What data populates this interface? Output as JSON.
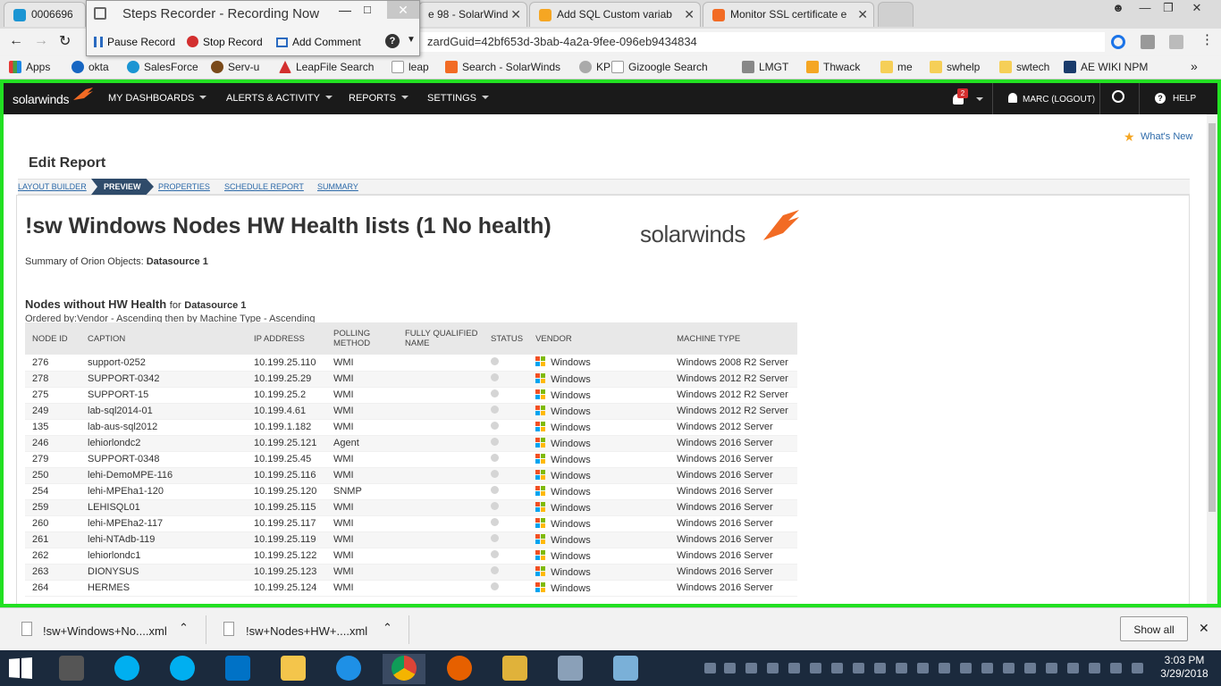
{
  "browser": {
    "tabs": [
      {
        "title": "0006696",
        "icon_color": "#1b95d3"
      },
      {
        "title": "e 98 - SolarWind",
        "icon_color": "#f57c00"
      },
      {
        "title": "Add SQL Custom variab",
        "icon_color": "#f5a623"
      },
      {
        "title": "Monitor SSL certificate e",
        "icon_color": "#f26b24"
      }
    ],
    "url": "zardGuid=42bf653d-3bab-4a2a-9fee-096eb9434834",
    "bookmarks": [
      "Apps",
      "okta",
      "SalesForce",
      "Serv-u",
      "LeapFile Search",
      "leap",
      "Search - SolarWinds",
      "KPI",
      "Gizoogle Search",
      "LMGT",
      "Thwack",
      "me",
      "swhelp",
      "swtech",
      "AE WIKI NPM"
    ],
    "bookmarks_more": "»"
  },
  "steps_recorder": {
    "title": "Steps Recorder - Recording Now",
    "pause": "Pause Record",
    "stop": "Stop Record",
    "comment": "Add Comment",
    "help": "?"
  },
  "swnav": {
    "logo": "solarwinds",
    "menus": [
      "MY DASHBOARDS",
      "ALERTS & ACTIVITY",
      "REPORTS",
      "SETTINGS"
    ],
    "alert_count": "2",
    "user": "MARC (LOGOUT)",
    "help": "HELP"
  },
  "page": {
    "whats_new": "What's New",
    "title": "Edit Report",
    "crumbs": [
      "LAYOUT BUILDER",
      "PREVIEW",
      "PROPERTIES",
      "SCHEDULE REPORT",
      "SUMMARY"
    ]
  },
  "report": {
    "title": "!sw Windows Nodes HW Health lists (1 No health)",
    "logo": "solarwinds",
    "summary_label": "Summary of Orion Objects:",
    "summary_value": "Datasource 1",
    "section_title": "Nodes without HW Health",
    "section_for": "for",
    "section_ds": "Datasource 1",
    "ordered_by": "Ordered by:Vendor - Ascending then by Machine Type - Ascending",
    "columns": [
      "NODE ID",
      "CAPTION",
      "IP ADDRESS",
      "POLLING METHOD",
      "FULLY QUALIFIED NAME",
      "STATUS",
      "VENDOR",
      "MACHINE TYPE"
    ],
    "rows": [
      [
        "276",
        "support-0252",
        "10.199.25.110",
        "WMI",
        "",
        "",
        "Windows",
        "Windows 2008 R2 Server"
      ],
      [
        "278",
        "SUPPORT-0342",
        "10.199.25.29",
        "WMI",
        "",
        "",
        "Windows",
        "Windows 2012 R2 Server"
      ],
      [
        "275",
        "SUPPORT-15",
        "10.199.25.2",
        "WMI",
        "",
        "",
        "Windows",
        "Windows 2012 R2 Server"
      ],
      [
        "249",
        "lab-sql2014-01",
        "10.199.4.61",
        "WMI",
        "",
        "",
        "Windows",
        "Windows 2012 R2 Server"
      ],
      [
        "135",
        "lab-aus-sql2012",
        "10.199.1.182",
        "WMI",
        "",
        "",
        "Windows",
        "Windows 2012 Server"
      ],
      [
        "246",
        "lehiorlondc2",
        "10.199.25.121",
        "Agent",
        "",
        "",
        "Windows",
        "Windows 2016 Server"
      ],
      [
        "279",
        "SUPPORT-0348",
        "10.199.25.45",
        "WMI",
        "",
        "",
        "Windows",
        "Windows 2016 Server"
      ],
      [
        "250",
        "lehi-DemoMPE-116",
        "10.199.25.116",
        "WMI",
        "",
        "",
        "Windows",
        "Windows 2016 Server"
      ],
      [
        "254",
        "lehi-MPEha1-120",
        "10.199.25.120",
        "SNMP",
        "",
        "",
        "Windows",
        "Windows 2016 Server"
      ],
      [
        "259",
        "LEHISQL01",
        "10.199.25.115",
        "WMI",
        "",
        "",
        "Windows",
        "Windows 2016 Server"
      ],
      [
        "260",
        "lehi-MPEha2-117",
        "10.199.25.117",
        "WMI",
        "",
        "",
        "Windows",
        "Windows 2016 Server"
      ],
      [
        "261",
        "lehi-NTAdb-119",
        "10.199.25.119",
        "WMI",
        "",
        "",
        "Windows",
        "Windows 2016 Server"
      ],
      [
        "262",
        "lehiorlondc1",
        "10.199.25.122",
        "WMI",
        "",
        "",
        "Windows",
        "Windows 2016 Server"
      ],
      [
        "263",
        "DIONYSUS",
        "10.199.25.123",
        "WMI",
        "",
        "",
        "Windows",
        "Windows 2016 Server"
      ],
      [
        "264",
        "HERMES",
        "10.199.25.124",
        "WMI",
        "",
        "",
        "Windows",
        "Windows 2016 Server"
      ]
    ]
  },
  "downloads": {
    "items": [
      "!sw+Windows+No....xml",
      "!sw+Nodes+HW+....xml"
    ],
    "show_all": "Show all",
    "close": "✕"
  },
  "taskbar": {
    "time": "3:03 PM",
    "date": "3/29/2018"
  }
}
